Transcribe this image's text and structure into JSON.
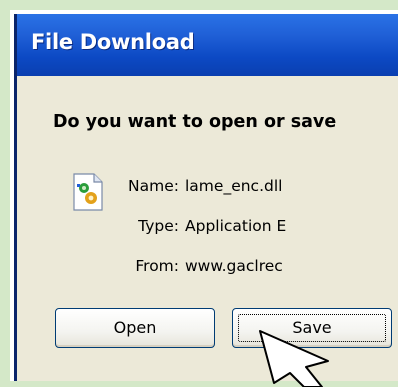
{
  "dialog": {
    "title": "File Download",
    "question": "Do you want to open or save",
    "file_icon": "application-dll-icon",
    "fields": [
      {
        "label": "Name:",
        "value": "lame_enc.dll"
      },
      {
        "label": "Type:",
        "value": "Application E"
      },
      {
        "label": "From:",
        "value": "www.gaclrec"
      }
    ],
    "buttons": {
      "open_label": "Open",
      "save_label": "Save"
    }
  },
  "colors": {
    "titlebar": "#0c49c4",
    "dialog_bg": "#ece9d8",
    "outer_bg": "#d4e8c8"
  },
  "cursor_icon": "arrow-cursor-icon"
}
